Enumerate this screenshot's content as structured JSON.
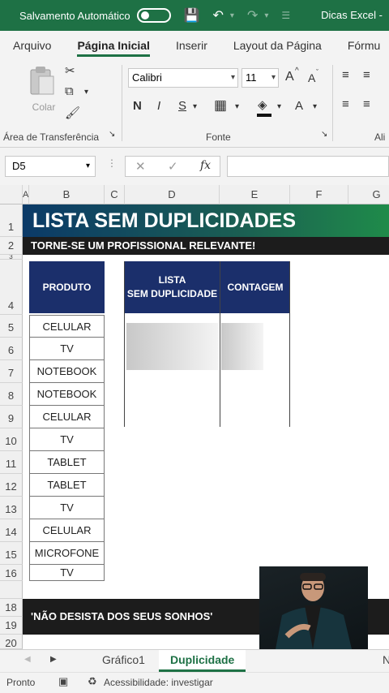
{
  "titlebar": {
    "autosave_label": "Salvamento Automático",
    "doc_title": "Dicas Excel -",
    "undo_icon": "undo-icon",
    "redo_icon": "redo-icon",
    "save_icon": "save-icon"
  },
  "ribbon_tabs": [
    "Arquivo",
    "Página Inicial",
    "Inserir",
    "Layout da Página",
    "Fórmu"
  ],
  "ribbon": {
    "paste_label": "Colar",
    "clipboard_group": "Área de Transferência",
    "font_group": "Fonte",
    "align_group": "Ali",
    "font_name": "Calibri",
    "font_size": "11",
    "bold": "N",
    "italic": "I",
    "underline": "S",
    "grow_font": "A",
    "shrink_font": "A",
    "font_color": "A"
  },
  "formula_bar": {
    "name_box": "D5",
    "fx": "fx"
  },
  "columns": [
    "A",
    "B",
    "C",
    "D",
    "E",
    "F",
    "G"
  ],
  "rows": [
    "1",
    "2",
    "3",
    "4",
    "5",
    "6",
    "7",
    "8",
    "9",
    "10",
    "11",
    "12",
    "13",
    "14",
    "15",
    "16",
    "17",
    "18",
    "19",
    "20"
  ],
  "sheet": {
    "title": "LISTA SEM DUPLICIDADES",
    "subtitle": "TORNE-SE UM PROFISSIONAL RELEVANTE!",
    "header_produto": "PRODUTO",
    "header_lista_1": "LISTA",
    "header_lista_2": "SEM DUPLICIDADE",
    "header_contagem": "CONTAGEM",
    "produtos": [
      "CELULAR",
      "TV",
      "NOTEBOOK",
      "NOTEBOOK",
      "CELULAR",
      "TV",
      "TABLET",
      "TABLET",
      "TV",
      "CELULAR",
      "MICROFONE",
      "TV"
    ],
    "quote": "'NÃO DESISTA DOS SEUS SONHOS'"
  },
  "sheet_tabs": {
    "tab1": "Gráfico1",
    "tab2": "Duplicidade",
    "tab3": "N"
  },
  "status": {
    "ready": "Pronto",
    "accessibility": "Acessibilidade: investigar"
  },
  "colors": {
    "excel_green": "#1e7145",
    "header_navy": "#1b2f6b"
  }
}
